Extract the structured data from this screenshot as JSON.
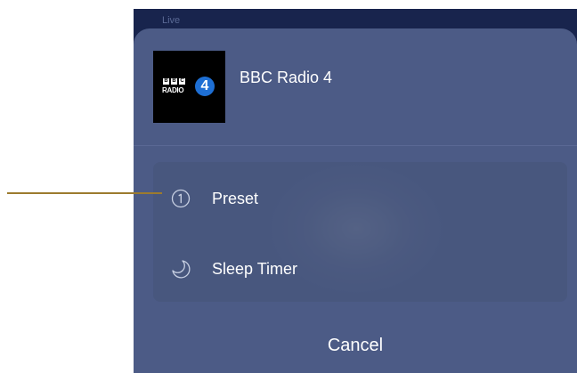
{
  "header": {
    "live_label": "Live"
  },
  "station": {
    "name": "BBC Radio 4",
    "logo": {
      "blocks": [
        "B",
        "B",
        "C"
      ],
      "word": "RADIO",
      "number": "4"
    }
  },
  "menu": {
    "items": [
      {
        "label": "Preset",
        "icon": "preset-circle-one-icon"
      },
      {
        "label": "Sleep Timer",
        "icon": "moon-icon"
      }
    ]
  },
  "cancel_label": "Cancel",
  "colors": {
    "sheet": "#4c5b86",
    "background": "#18244d",
    "logo_accent": "#1e6fd4",
    "pointer_line": "#9c7b2e"
  }
}
